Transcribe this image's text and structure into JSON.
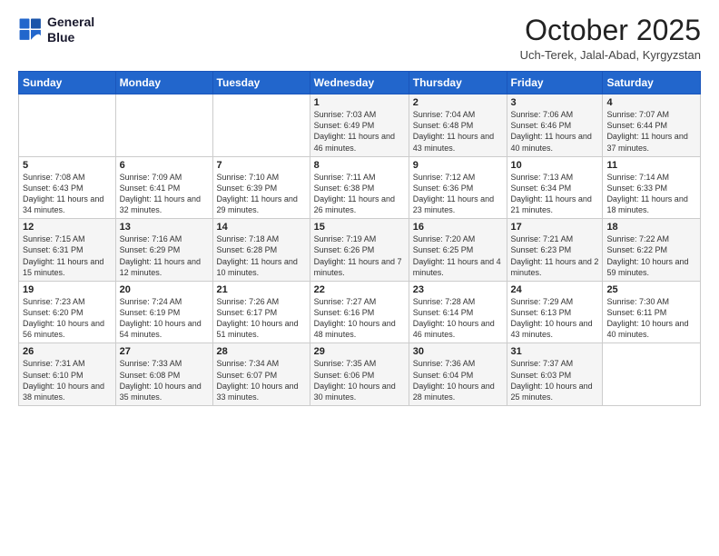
{
  "header": {
    "logo_line1": "General",
    "logo_line2": "Blue",
    "month_title": "October 2025",
    "subtitle": "Uch-Terek, Jalal-Abad, Kyrgyzstan"
  },
  "days_of_week": [
    "Sunday",
    "Monday",
    "Tuesday",
    "Wednesday",
    "Thursday",
    "Friday",
    "Saturday"
  ],
  "weeks": [
    [
      {
        "day": "",
        "info": ""
      },
      {
        "day": "",
        "info": ""
      },
      {
        "day": "",
        "info": ""
      },
      {
        "day": "1",
        "info": "Sunrise: 7:03 AM\nSunset: 6:49 PM\nDaylight: 11 hours and 46 minutes."
      },
      {
        "day": "2",
        "info": "Sunrise: 7:04 AM\nSunset: 6:48 PM\nDaylight: 11 hours and 43 minutes."
      },
      {
        "day": "3",
        "info": "Sunrise: 7:06 AM\nSunset: 6:46 PM\nDaylight: 11 hours and 40 minutes."
      },
      {
        "day": "4",
        "info": "Sunrise: 7:07 AM\nSunset: 6:44 PM\nDaylight: 11 hours and 37 minutes."
      }
    ],
    [
      {
        "day": "5",
        "info": "Sunrise: 7:08 AM\nSunset: 6:43 PM\nDaylight: 11 hours and 34 minutes."
      },
      {
        "day": "6",
        "info": "Sunrise: 7:09 AM\nSunset: 6:41 PM\nDaylight: 11 hours and 32 minutes."
      },
      {
        "day": "7",
        "info": "Sunrise: 7:10 AM\nSunset: 6:39 PM\nDaylight: 11 hours and 29 minutes."
      },
      {
        "day": "8",
        "info": "Sunrise: 7:11 AM\nSunset: 6:38 PM\nDaylight: 11 hours and 26 minutes."
      },
      {
        "day": "9",
        "info": "Sunrise: 7:12 AM\nSunset: 6:36 PM\nDaylight: 11 hours and 23 minutes."
      },
      {
        "day": "10",
        "info": "Sunrise: 7:13 AM\nSunset: 6:34 PM\nDaylight: 11 hours and 21 minutes."
      },
      {
        "day": "11",
        "info": "Sunrise: 7:14 AM\nSunset: 6:33 PM\nDaylight: 11 hours and 18 minutes."
      }
    ],
    [
      {
        "day": "12",
        "info": "Sunrise: 7:15 AM\nSunset: 6:31 PM\nDaylight: 11 hours and 15 minutes."
      },
      {
        "day": "13",
        "info": "Sunrise: 7:16 AM\nSunset: 6:29 PM\nDaylight: 11 hours and 12 minutes."
      },
      {
        "day": "14",
        "info": "Sunrise: 7:18 AM\nSunset: 6:28 PM\nDaylight: 11 hours and 10 minutes."
      },
      {
        "day": "15",
        "info": "Sunrise: 7:19 AM\nSunset: 6:26 PM\nDaylight: 11 hours and 7 minutes."
      },
      {
        "day": "16",
        "info": "Sunrise: 7:20 AM\nSunset: 6:25 PM\nDaylight: 11 hours and 4 minutes."
      },
      {
        "day": "17",
        "info": "Sunrise: 7:21 AM\nSunset: 6:23 PM\nDaylight: 11 hours and 2 minutes."
      },
      {
        "day": "18",
        "info": "Sunrise: 7:22 AM\nSunset: 6:22 PM\nDaylight: 10 hours and 59 minutes."
      }
    ],
    [
      {
        "day": "19",
        "info": "Sunrise: 7:23 AM\nSunset: 6:20 PM\nDaylight: 10 hours and 56 minutes."
      },
      {
        "day": "20",
        "info": "Sunrise: 7:24 AM\nSunset: 6:19 PM\nDaylight: 10 hours and 54 minutes."
      },
      {
        "day": "21",
        "info": "Sunrise: 7:26 AM\nSunset: 6:17 PM\nDaylight: 10 hours and 51 minutes."
      },
      {
        "day": "22",
        "info": "Sunrise: 7:27 AM\nSunset: 6:16 PM\nDaylight: 10 hours and 48 minutes."
      },
      {
        "day": "23",
        "info": "Sunrise: 7:28 AM\nSunset: 6:14 PM\nDaylight: 10 hours and 46 minutes."
      },
      {
        "day": "24",
        "info": "Sunrise: 7:29 AM\nSunset: 6:13 PM\nDaylight: 10 hours and 43 minutes."
      },
      {
        "day": "25",
        "info": "Sunrise: 7:30 AM\nSunset: 6:11 PM\nDaylight: 10 hours and 40 minutes."
      }
    ],
    [
      {
        "day": "26",
        "info": "Sunrise: 7:31 AM\nSunset: 6:10 PM\nDaylight: 10 hours and 38 minutes."
      },
      {
        "day": "27",
        "info": "Sunrise: 7:33 AM\nSunset: 6:08 PM\nDaylight: 10 hours and 35 minutes."
      },
      {
        "day": "28",
        "info": "Sunrise: 7:34 AM\nSunset: 6:07 PM\nDaylight: 10 hours and 33 minutes."
      },
      {
        "day": "29",
        "info": "Sunrise: 7:35 AM\nSunset: 6:06 PM\nDaylight: 10 hours and 30 minutes."
      },
      {
        "day": "30",
        "info": "Sunrise: 7:36 AM\nSunset: 6:04 PM\nDaylight: 10 hours and 28 minutes."
      },
      {
        "day": "31",
        "info": "Sunrise: 7:37 AM\nSunset: 6:03 PM\nDaylight: 10 hours and 25 minutes."
      },
      {
        "day": "",
        "info": ""
      }
    ]
  ]
}
